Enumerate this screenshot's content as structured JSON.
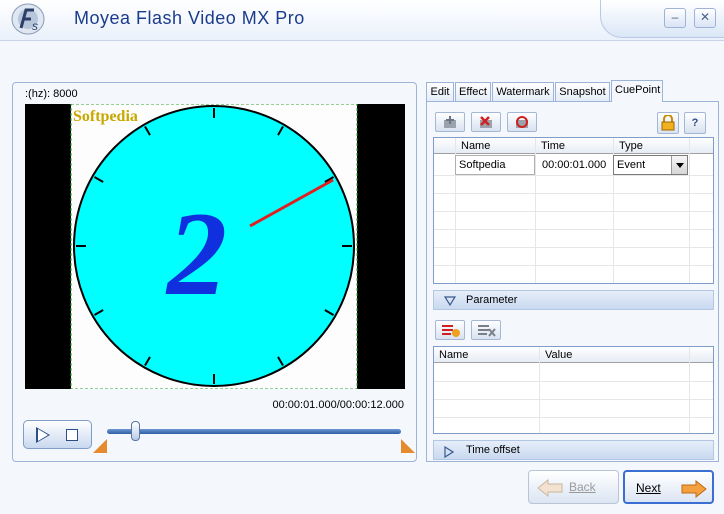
{
  "window": {
    "title": "Moyea Flash Video MX Pro",
    "minimize_label": "–",
    "close_label": "✕"
  },
  "preview": {
    "rate_label": ":(hz): 8000",
    "watermark_text": "Softpedia",
    "clock_digit": "2",
    "timecode": "00:00:01.000/00:00:12.000",
    "seek_position": 0.08
  },
  "tabs": [
    {
      "label": "Edit",
      "active": false
    },
    {
      "label": "Effect",
      "active": false
    },
    {
      "label": "Watermark",
      "active": false
    },
    {
      "label": "Snapshot",
      "active": false
    },
    {
      "label": "CuePoint",
      "active": true
    }
  ],
  "cuepoint": {
    "help_label": "?",
    "columns": [
      "Name",
      "Time",
      "Type"
    ],
    "rows": [
      {
        "name": "Softpedia",
        "time": "00:00:01.000",
        "type": "Event"
      }
    ],
    "parameter_section": "Parameter",
    "param_columns": [
      "Name",
      "Value"
    ],
    "time_offset_section": "Time offset"
  },
  "nav": {
    "back_label": "Back",
    "next_label": "Next"
  },
  "colors": {
    "accent": "#3a6ed0",
    "clock_face": "#00ffff",
    "clock_hand": "#e02020",
    "digit": "#1030e0",
    "watermark": "#c8a800",
    "marker": "#e68a2e"
  }
}
